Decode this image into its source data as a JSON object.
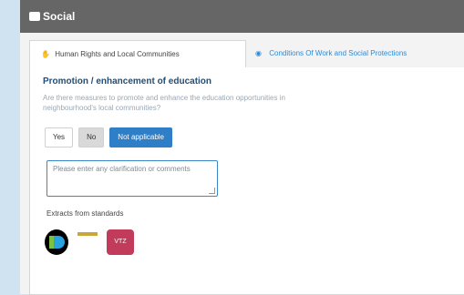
{
  "header": {
    "title": "Social"
  },
  "tabs": [
    {
      "label": "Human Rights and Local Communities",
      "icon": "hand-icon",
      "active": true
    },
    {
      "label": "Conditions Of Work and Social Protections",
      "icon": "eye-icon",
      "active": false
    }
  ],
  "question": {
    "title": "Promotion / enhancement of education",
    "text": "Are there measures to promote and enhance the education opportunities in neighbourhood's local communities?"
  },
  "answers": {
    "yes": "Yes",
    "no": "No",
    "na": "Not applicable",
    "selected": "Not applicable"
  },
  "comment": {
    "placeholder": "Please enter any clarification or comments"
  },
  "extracts": {
    "label": "Extracts from standards"
  },
  "logos": {
    "third_label": "VTZ"
  },
  "colors": {
    "header_bg": "#666666",
    "accent": "#2f7fc8",
    "page_bg": "#cfe3f1"
  }
}
